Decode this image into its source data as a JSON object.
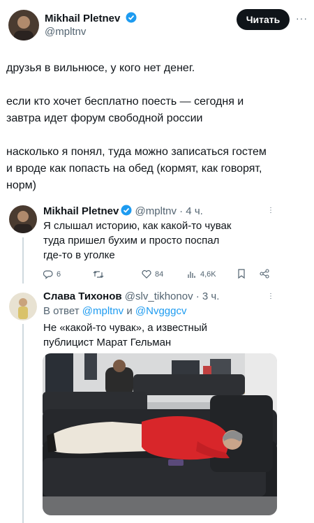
{
  "main_post": {
    "author_name": "Mikhail Pletnev",
    "author_handle": "@mpltnv",
    "read_button": "Читать",
    "more": "···",
    "text_lines": [
      "друзья в вильнюсе, у кого нет денег.",
      "",
      "если кто хочет бесплатно поесть — сегодня и",
      "завтра идет форум свободной россии",
      "",
      "насколько я понял, туда можно записаться гостем",
      "и вроде как попасть на обед (кормят, как говорят,",
      "норм)"
    ]
  },
  "reply1": {
    "author_name": "Mikhail Pletnev",
    "author_handle": "@mpltnv",
    "time": "· 4 ч.",
    "text_lines": [
      "Я слышал историю, как какой-то чувак",
      "туда пришел бухим и просто поспал",
      "где-то в уголке"
    ],
    "actions": {
      "replies": "6",
      "retweets": "",
      "likes": "84",
      "views": "4,6K"
    }
  },
  "reply2": {
    "author_name": "Слава Тихонов",
    "author_handle": "@slv_tikhonov",
    "time": "· 3 ч.",
    "reply_prefix": "В ответ",
    "reply_to_1": "@mpltnv",
    "reply_and": "и",
    "reply_to_2": "@Nvgggcv",
    "text_lines": [
      "Не «какой-то чувак», а известный",
      "публицист Марат Гельман"
    ]
  },
  "colors": {
    "accent": "#1d9bf0",
    "text": "#0f1419",
    "muted": "#536471",
    "sweater": "#d8262a"
  },
  "icons": [
    "verified-icon",
    "reply-icon",
    "retweet-icon",
    "like-icon",
    "views-icon",
    "bookmark-icon",
    "share-icon"
  ]
}
